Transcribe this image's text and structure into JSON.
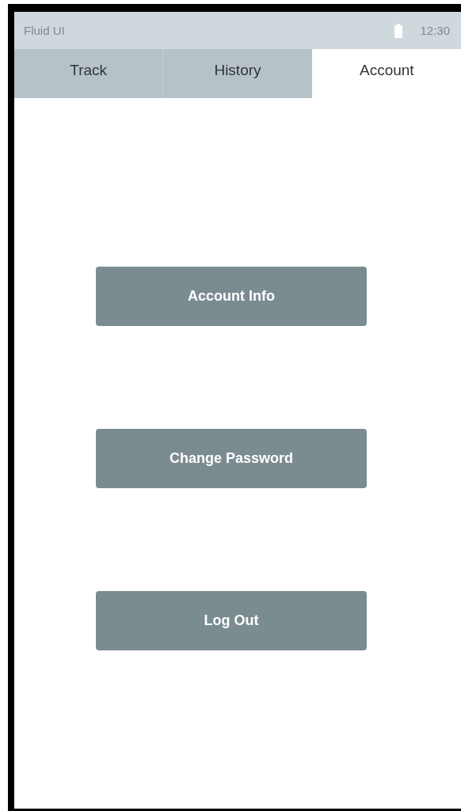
{
  "status_bar": {
    "title": "Fluid UI",
    "time": "12:30"
  },
  "tabs": [
    {
      "label": "Track",
      "selected": false
    },
    {
      "label": "History",
      "selected": false
    },
    {
      "label": "Account",
      "selected": true
    }
  ],
  "buttons": [
    "Account Info",
    "Change Password",
    "Log Out"
  ]
}
